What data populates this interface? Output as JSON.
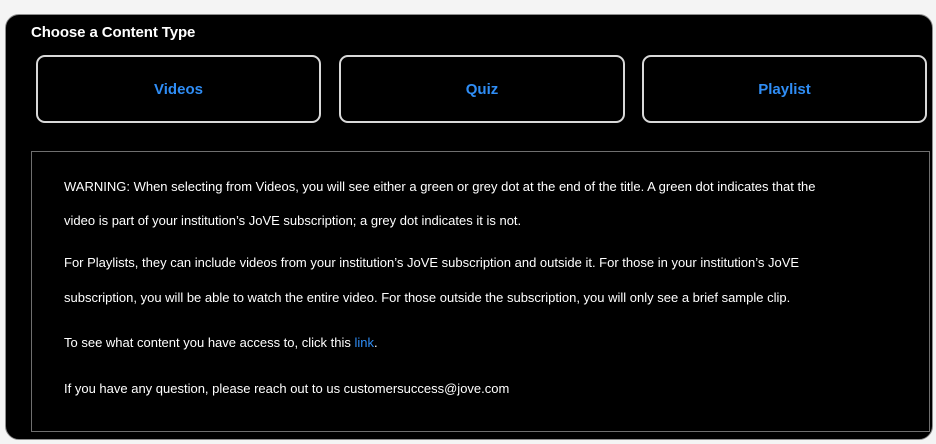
{
  "panel": {
    "title": "Choose a Content Type"
  },
  "content_types": [
    {
      "label": "Videos"
    },
    {
      "label": "Quiz"
    },
    {
      "label": "Playlist"
    }
  ],
  "info": {
    "warning_line1": "WARNING: When selecting from Videos, you will see either a green or grey dot at the end of the title. A green dot indicates that the",
    "warning_line2": "video is part of your institution’s JoVE subscription; a grey dot indicates it is not.",
    "playlist_line1": "For Playlists, they can include videos from your institution’s JoVE subscription and outside it. For those in your institution’s JoVE",
    "playlist_line2": "subscription, you will be able to watch the entire video. For those outside the subscription, you will only see a brief sample clip.",
    "access_prefix": "To see what content you have access to, click this ",
    "access_link": "link",
    "access_suffix": ".",
    "contact_line": "If you have any question, please reach out to us customersuccess@jove.com"
  },
  "colors": {
    "background": "#000000",
    "accent": "#2f8df5",
    "button_border": "#d9d9d9",
    "text": "#ffffff"
  }
}
